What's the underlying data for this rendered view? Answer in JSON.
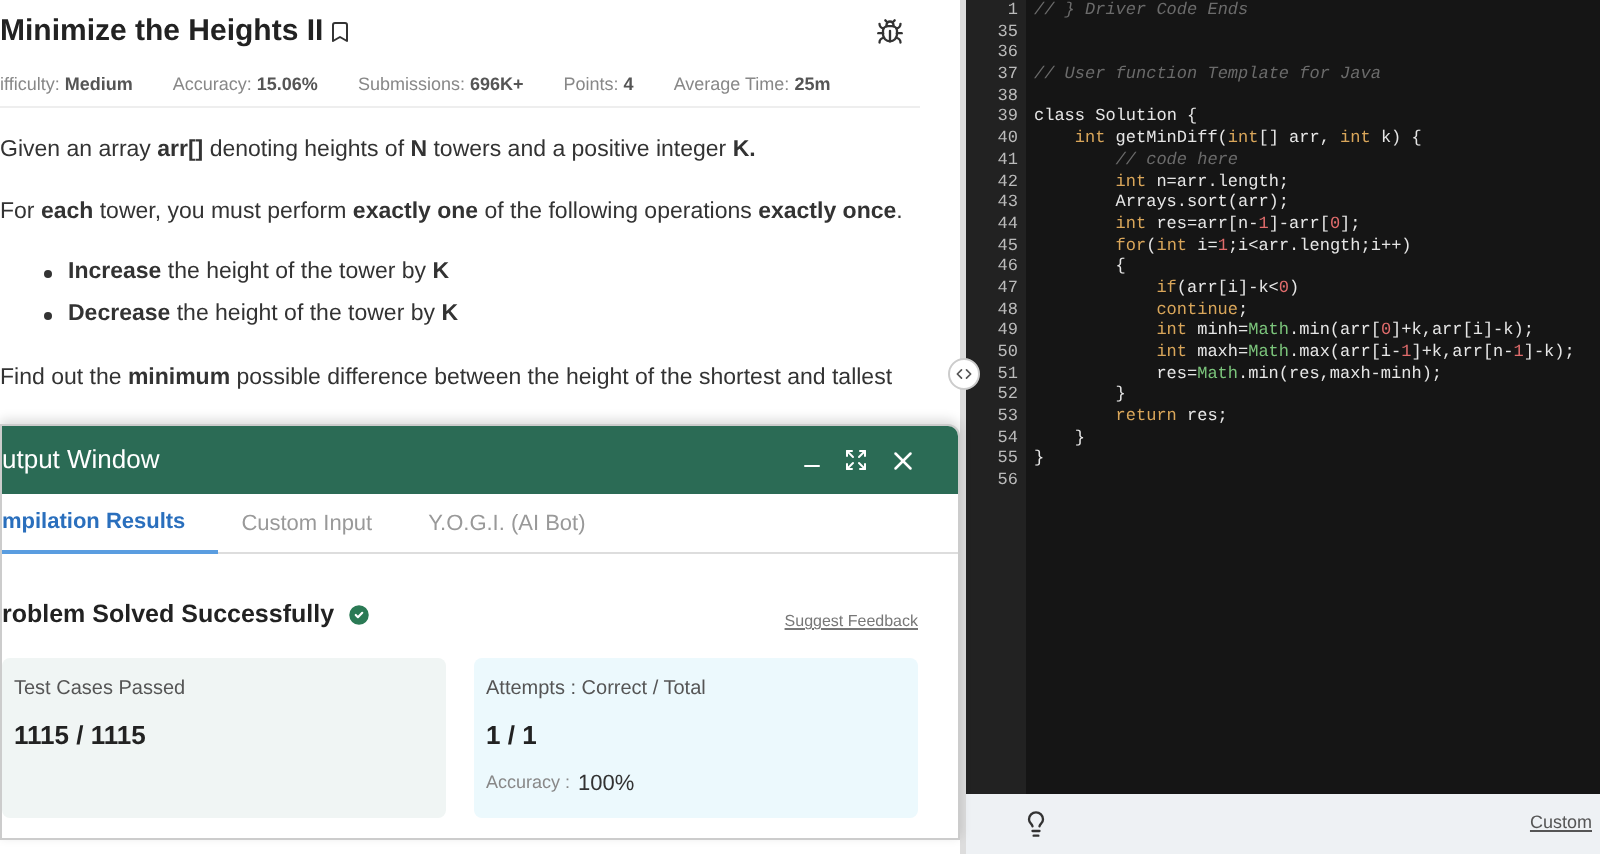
{
  "problem": {
    "title": "Minimize the Heights II",
    "meta": [
      {
        "label": "ifficulty:",
        "value": "Medium"
      },
      {
        "label": "Accuracy:",
        "value": "15.06%"
      },
      {
        "label": "Submissions:",
        "value": "696K+"
      },
      {
        "label": "Points:",
        "value": "4"
      },
      {
        "label": "Average Time:",
        "value": "25m"
      }
    ],
    "paragraphs": [
      {
        "kind": "text",
        "text": "Given an array **arr[]** denoting heights of **N** towers and a positive integer **K.**"
      },
      {
        "kind": "text",
        "text": "For **each** tower, you must perform **exactly one** of the following operations **exactly once**."
      },
      {
        "kind": "bullets",
        "items": [
          "**Increase** the height of the tower by **K**",
          "**Decrease** the height of the tower by **K**"
        ]
      },
      {
        "kind": "text",
        "text": "Find out the **minimum** possible difference between the height of the shortest and tallest"
      }
    ]
  },
  "output_window": {
    "title": "utput Window",
    "tabs": [
      {
        "label": "mpilation Results",
        "selected": true
      },
      {
        "label": "Custom Input",
        "selected": false
      },
      {
        "label": "Y.O.G.I. (AI Bot)",
        "selected": false
      }
    ],
    "status": "roblem Solved Successfully",
    "feedback_link": "Suggest Feedback",
    "cards": [
      {
        "label": "Test Cases Passed",
        "value": "1115 / 1115"
      },
      {
        "label": "Attempts : Correct / Total",
        "value": "1 / 1",
        "sub_label": "Accuracy :",
        "sub_value": "100%"
      }
    ]
  },
  "editor": {
    "lines": [
      {
        "number": "1",
        "tokens": [
          {
            "text": "// } Driver Code Ends",
            "kind": "comment"
          }
        ]
      },
      {
        "number": "35"
      },
      {
        "number": "36"
      },
      {
        "number": "37",
        "tokens": [
          {
            "text": "// User function Template for Java",
            "kind": "comment"
          }
        ]
      },
      {
        "number": "38"
      },
      {
        "number": "39",
        "tokens": [
          {
            "text": "class",
            "kind": "plain"
          },
          {
            "text": " Solution {",
            "kind": "plain"
          }
        ]
      },
      {
        "number": "40",
        "tokens": [
          {
            "text": "    int",
            "kind": "kw"
          },
          {
            "text": " getMinDiff(",
            "kind": "plain"
          },
          {
            "text": "int",
            "kind": "kw"
          },
          {
            "text": "[] arr, ",
            "kind": "plain"
          },
          {
            "text": "int",
            "kind": "kw"
          },
          {
            "text": " k) {",
            "kind": "plain"
          }
        ]
      },
      {
        "number": "41",
        "tokens": [
          {
            "text": "        // code here",
            "kind": "comment"
          }
        ]
      },
      {
        "number": "42",
        "tokens": [
          {
            "text": "        int",
            "kind": "kw"
          },
          {
            "text": " n=arr.length;",
            "kind": "plain"
          }
        ]
      },
      {
        "number": "43",
        "tokens": [
          {
            "text": "        Arrays.sort(arr);",
            "kind": "plain"
          }
        ]
      },
      {
        "number": "44",
        "tokens": [
          {
            "text": "        int",
            "kind": "kw"
          },
          {
            "text": " res=arr[n-",
            "kind": "plain"
          },
          {
            "text": "1",
            "kind": "num"
          },
          {
            "text": "]-arr[",
            "kind": "plain"
          },
          {
            "text": "0",
            "kind": "num"
          },
          {
            "text": "];",
            "kind": "plain"
          }
        ]
      },
      {
        "number": "45",
        "tokens": [
          {
            "text": "        for",
            "kind": "kw"
          },
          {
            "text": "(",
            "kind": "plain"
          },
          {
            "text": "int",
            "kind": "kw"
          },
          {
            "text": " i=",
            "kind": "plain"
          },
          {
            "text": "1",
            "kind": "num"
          },
          {
            "text": ";i<arr.length;i++)",
            "kind": "plain"
          }
        ]
      },
      {
        "number": "46",
        "tokens": [
          {
            "text": "        {",
            "kind": "plain"
          }
        ]
      },
      {
        "number": "47",
        "tokens": [
          {
            "text": "            if",
            "kind": "kw"
          },
          {
            "text": "(arr[i]-k<",
            "kind": "plain"
          },
          {
            "text": "0",
            "kind": "num"
          },
          {
            "text": ")",
            "kind": "plain"
          }
        ]
      },
      {
        "number": "48",
        "tokens": [
          {
            "text": "            continue",
            "kind": "kw"
          },
          {
            "text": ";",
            "kind": "plain"
          }
        ]
      },
      {
        "number": "49",
        "tokens": [
          {
            "text": "            int",
            "kind": "kw"
          },
          {
            "text": " minh=",
            "kind": "plain"
          },
          {
            "text": "Math",
            "kind": "cls"
          },
          {
            "text": ".min(arr[",
            "kind": "plain"
          },
          {
            "text": "0",
            "kind": "num"
          },
          {
            "text": "]+k,arr[i]-k);",
            "kind": "plain"
          }
        ]
      },
      {
        "number": "50",
        "tokens": [
          {
            "text": "            int",
            "kind": "kw"
          },
          {
            "text": " maxh=",
            "kind": "plain"
          },
          {
            "text": "Math",
            "kind": "cls"
          },
          {
            "text": ".max(arr[i-",
            "kind": "plain"
          },
          {
            "text": "1",
            "kind": "num"
          },
          {
            "text": "]+k,arr[n-",
            "kind": "plain"
          },
          {
            "text": "1",
            "kind": "num"
          },
          {
            "text": "]-k);",
            "kind": "plain"
          }
        ]
      },
      {
        "number": "51",
        "tokens": [
          {
            "text": "            res=",
            "kind": "plain"
          },
          {
            "text": "Math",
            "kind": "cls"
          },
          {
            "text": ".min(res,maxh-minh);",
            "kind": "plain"
          }
        ]
      },
      {
        "number": "52",
        "tokens": [
          {
            "text": "        }",
            "kind": "plain"
          }
        ]
      },
      {
        "number": "53",
        "tokens": [
          {
            "text": "        return",
            "kind": "kw"
          },
          {
            "text": " res;",
            "kind": "plain"
          }
        ]
      },
      {
        "number": "54",
        "tokens": [
          {
            "text": "    }",
            "kind": "plain"
          }
        ]
      },
      {
        "number": "55",
        "tokens": [
          {
            "text": "}",
            "kind": "plain"
          }
        ]
      },
      {
        "number": "56"
      }
    ],
    "footer_link": "Custom"
  }
}
